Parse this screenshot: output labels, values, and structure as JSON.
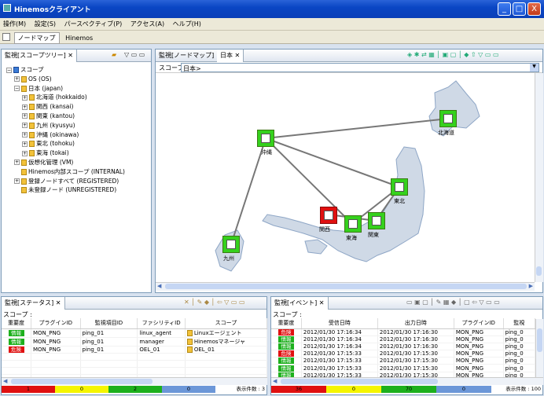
{
  "window": {
    "title": "Hinemosクライアント",
    "min": "_",
    "max": "□",
    "close": "X"
  },
  "menu": [
    "操作(M)",
    "設定(S)",
    "パースペクティブ(P)",
    "アクセス(A)",
    "ヘルプ(H)"
  ],
  "perspectives": [
    "ノードマップ",
    "Hinemos"
  ],
  "scope_tree": {
    "tab": "監視[スコープツリー]",
    "items": [
      {
        "label": "スコープ",
        "indent": 0,
        "toggle": "−"
      },
      {
        "label": "OS (OS)",
        "indent": 1,
        "toggle": "+"
      },
      {
        "label": "日本 (japan)",
        "indent": 1,
        "toggle": "−"
      },
      {
        "label": "北海道 (hokkaido)",
        "indent": 2,
        "toggle": "+"
      },
      {
        "label": "関西 (kansai)",
        "indent": 2,
        "toggle": "+"
      },
      {
        "label": "関東 (kantou)",
        "indent": 2,
        "toggle": "+"
      },
      {
        "label": "九州 (kyusyu)",
        "indent": 2,
        "toggle": "+"
      },
      {
        "label": "沖縄 (okinawa)",
        "indent": 2,
        "toggle": "+"
      },
      {
        "label": "東北 (tohoku)",
        "indent": 2,
        "toggle": "+"
      },
      {
        "label": "東海 (tokai)",
        "indent": 2,
        "toggle": "+"
      },
      {
        "label": "仮想化管理 (VM)",
        "indent": 1,
        "toggle": "+"
      },
      {
        "label": "Hinemos内部スコープ (INTERNAL)",
        "indent": 1,
        "toggle": ""
      },
      {
        "label": "登録ノードすべて (REGISTERED)",
        "indent": 1,
        "toggle": "+"
      },
      {
        "label": "未登録ノード (UNREGISTERED)",
        "indent": 1,
        "toggle": ""
      }
    ]
  },
  "node_map": {
    "tab1": "監視[ノードマップ]",
    "tab2": "日本",
    "scope_label": "スコープ :",
    "scope_value": "日本>",
    "nodes": [
      {
        "label": "沖縄",
        "status": "ok"
      },
      {
        "label": "北海道",
        "status": "ok"
      },
      {
        "label": "東北",
        "status": "ok"
      },
      {
        "label": "関西",
        "status": "critical"
      },
      {
        "label": "東海",
        "status": "ok"
      },
      {
        "label": "関東",
        "status": "ok"
      },
      {
        "label": "九州",
        "status": "ok"
      }
    ]
  },
  "status_panel": {
    "tab": "監視[ステータス]",
    "scope": "スコープ :",
    "headers": [
      "重要度",
      "プラグインID",
      "監視項目ID",
      "ファシリティID",
      "スコープ"
    ],
    "rows": [
      {
        "sev": "情報",
        "color": "#1db01d",
        "plugin": "MON_PNG",
        "item": "ping_01",
        "facility": "linux_agent",
        "scope": "Linuxエージェント"
      },
      {
        "sev": "情報",
        "color": "#1db01d",
        "plugin": "MON_PNG",
        "item": "ping_01",
        "facility": "manager",
        "scope": "Hinemosマネージャ"
      },
      {
        "sev": "危険",
        "color": "#e01010",
        "plugin": "MON_PNG",
        "item": "ping_01",
        "facility": "OEL_01",
        "scope": "OEL_01"
      }
    ],
    "counts": [
      "1",
      "0",
      "2",
      "0"
    ],
    "total": "表示件数 : 3"
  },
  "event_panel": {
    "tab": "監視[イベント]",
    "scope": "スコープ :",
    "headers": [
      "重要度",
      "受信日時",
      "出力日時",
      "プラグインID",
      "監視"
    ],
    "rows": [
      {
        "sev": "危険",
        "color": "#e01010",
        "recv": "2012/01/30 17:16:34",
        "out": "2012/01/30 17:16:30",
        "plugin": "MON_PNG",
        "item": "ping_0"
      },
      {
        "sev": "情報",
        "color": "#1db01d",
        "recv": "2012/01/30 17:16:34",
        "out": "2012/01/30 17:16:30",
        "plugin": "MON_PNG",
        "item": "ping_0"
      },
      {
        "sev": "情報",
        "color": "#1db01d",
        "recv": "2012/01/30 17:16:34",
        "out": "2012/01/30 17:16:30",
        "plugin": "MON_PNG",
        "item": "ping_0"
      },
      {
        "sev": "危険",
        "color": "#e01010",
        "recv": "2012/01/30 17:15:33",
        "out": "2012/01/30 17:15:30",
        "plugin": "MON_PNG",
        "item": "ping_0"
      },
      {
        "sev": "情報",
        "color": "#1db01d",
        "recv": "2012/01/30 17:15:33",
        "out": "2012/01/30 17:15:30",
        "plugin": "MON_PNG",
        "item": "ping_0"
      },
      {
        "sev": "情報",
        "color": "#1db01d",
        "recv": "2012/01/30 17:15:33",
        "out": "2012/01/30 17:15:30",
        "plugin": "MON_PNG",
        "item": "ping_0"
      },
      {
        "sev": "情報",
        "color": "#1db01d",
        "recv": "2012/01/30 17:15:33",
        "out": "2012/01/30 17:15:30",
        "plugin": "MON_PNG",
        "item": "ping_0"
      }
    ],
    "counts": [
      "36",
      "0",
      "70",
      "0"
    ],
    "total": "表示件数 : 100"
  },
  "colors": {
    "critical": "#e01010",
    "warning": "#f5f500",
    "info": "#1db01d",
    "unknown": "#6c97d8"
  }
}
